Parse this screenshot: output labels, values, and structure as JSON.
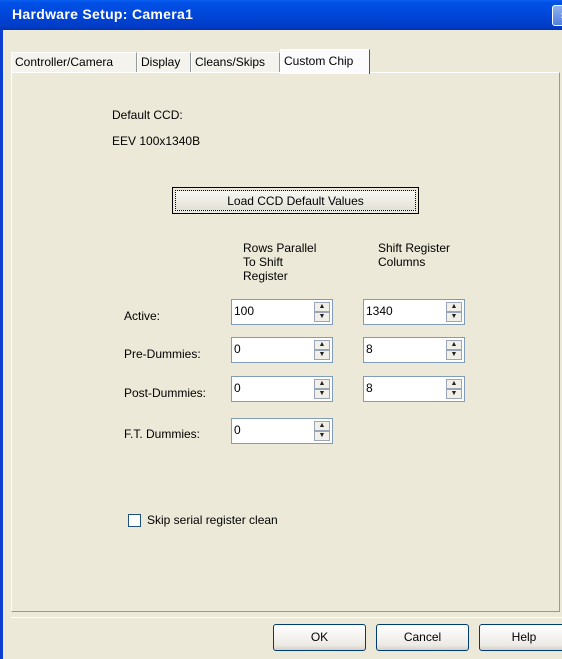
{
  "window": {
    "title": "Hardware Setup: Camera1"
  },
  "tabs": [
    {
      "label": "Controller/Camera"
    },
    {
      "label": "Display"
    },
    {
      "label": "Cleans/Skips"
    },
    {
      "label": "Custom Chip",
      "active": true
    }
  ],
  "ccd": {
    "default_label": "Default CCD:",
    "default_value": "EEV 100x1340B",
    "load_button": "Load CCD Default Values"
  },
  "columns": {
    "rows_header": "Rows Parallel To Shift Register",
    "rows_header_lines": [
      "Rows Parallel",
      "To Shift",
      "Register"
    ],
    "cols_header_lines": [
      "Shift Register",
      "Columns"
    ]
  },
  "fields": {
    "active": {
      "label": "Active:",
      "rows": "100",
      "cols": "1340"
    },
    "pre_dummies": {
      "label": "Pre-Dummies:",
      "rows": "0",
      "cols": "8"
    },
    "post_dummies": {
      "label": "Post-Dummies:",
      "rows": "0",
      "cols": "8"
    },
    "ft_dummies": {
      "label": "F.T. Dummies:",
      "rows": "0"
    }
  },
  "options": {
    "skip_serial_clean": {
      "label": "Skip serial register clean",
      "checked": false
    }
  },
  "buttons": {
    "ok": "OK",
    "cancel": "Cancel",
    "help": "Help"
  },
  "icons": {
    "spin_up": "▲",
    "spin_down": "▼"
  },
  "colors": {
    "titlebar": "#0046d8",
    "dialog_bg": "#ece9d8",
    "field_border": "#7f9db9"
  }
}
